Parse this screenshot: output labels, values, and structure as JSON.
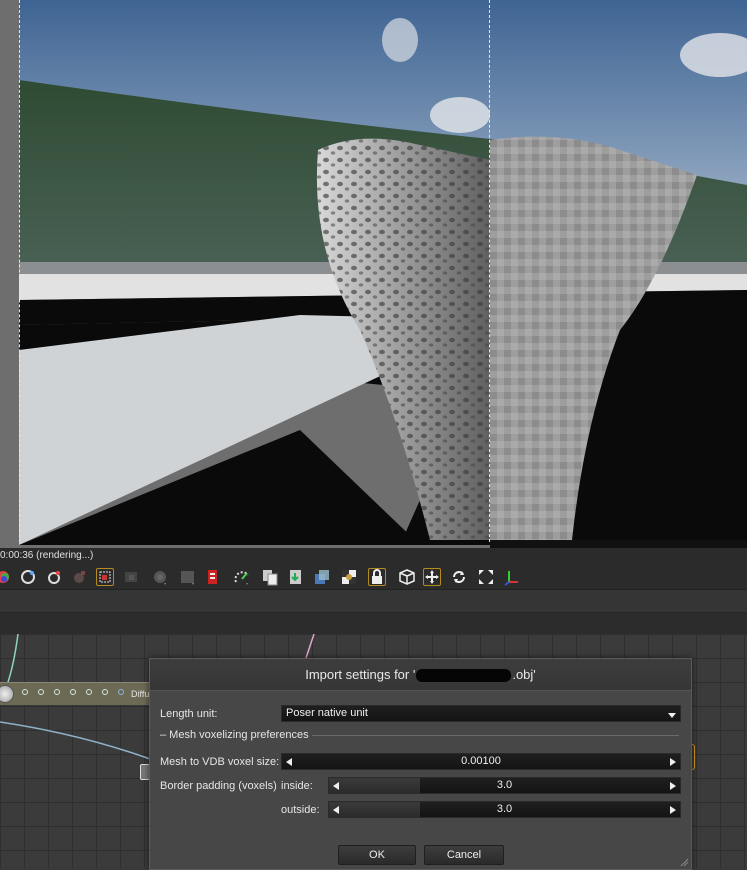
{
  "render": {
    "status": "0:00:36 (rendering...)"
  },
  "toolbar": {
    "icons": [
      "render-icon",
      "materials-icon",
      "light-icon",
      "ghost-icon",
      "area-render-icon",
      "grayed-render-icon",
      "camera-icon",
      "solid-box-icon",
      "tag-icon",
      "sparkle-icon",
      "copy-icon",
      "download-icon",
      "layers-icon",
      "checker-icon",
      "lock-icon",
      "cube-icon",
      "move-icon",
      "rotate-icon",
      "expand-icon",
      "axes-icon"
    ]
  },
  "node_editor": {
    "node_label": "Diffu"
  },
  "dialog": {
    "title_prefix": "Import settings for '",
    "title_suffix": ".obj'",
    "length_unit_label": "Length unit:",
    "length_unit_value": "Poser native unit",
    "section_label": "– Mesh voxelizing preferences",
    "voxel_size_label": "Mesh to VDB voxel size:",
    "voxel_size_value": "0.00100",
    "border_padding_label": "Border padding (voxels)",
    "inside_label": "inside:",
    "inside_value": "3.0",
    "inside_fill": 0.26,
    "outside_label": "outside:",
    "outside_value": "3.0",
    "outside_fill": 0.26,
    "ok_label": "OK",
    "cancel_label": "Cancel"
  }
}
